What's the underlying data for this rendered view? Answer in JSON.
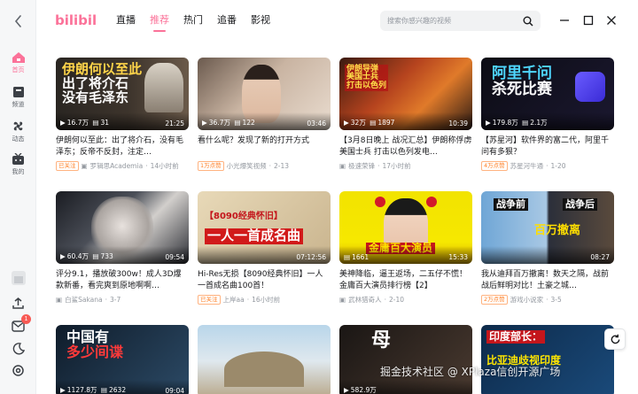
{
  "app": {
    "logo_text": "bilibili"
  },
  "header": {
    "tabs": [
      {
        "label": "直播",
        "active": false
      },
      {
        "label": "推荐",
        "active": true
      },
      {
        "label": "热门",
        "active": false
      },
      {
        "label": "追番",
        "active": false
      },
      {
        "label": "影视",
        "active": false
      }
    ],
    "search": {
      "placeholder": "搜索你感兴趣的视频"
    }
  },
  "sidebar": {
    "items": [
      {
        "label": "首页",
        "icon": "home-icon",
        "active": true
      },
      {
        "label": "频道",
        "icon": "channel-icon",
        "active": false
      },
      {
        "label": "动态",
        "icon": "dynamic-icon",
        "active": false
      },
      {
        "label": "我的",
        "icon": "my-icon",
        "active": false
      }
    ],
    "notification_count": "1"
  },
  "colors": {
    "accent": "#fb7299",
    "tag": "#ff7f24"
  },
  "videos": [
    {
      "thumb_text": "伊朗何以至此\n出了将介石\n没有毛泽东",
      "views": "16.7万",
      "comments": "31",
      "duration": "21:25",
      "title": "伊朗何以至此：出了将介石，没有毛泽东；反帝不反封，注定…",
      "tag": "已关注",
      "author": "罗辑思Academia",
      "time": "14小时前"
    },
    {
      "thumb_text": "",
      "views": "36.7万",
      "comments": "122",
      "duration": "03:46",
      "title": "看什么呢？发现了新的打开方式",
      "tag": "1万点赞",
      "author": "小光爆笑视频",
      "time": "2-13"
    },
    {
      "thumb_text": "伊朗导弹\n美国士兵\n打击以色列",
      "views": "32万",
      "comments": "1897",
      "duration": "10:39",
      "title": "【3月8日晚上 战况汇总】伊朗称俘虏美国士兵 打击以色列发电…",
      "tag": "",
      "author": "极速荣锋",
      "time": "17小时前"
    },
    {
      "thumb_text": "阿里千问\n杀死比赛",
      "views": "179.8万",
      "comments": "2.1万",
      "duration": "",
      "title": "【苏星河】软件界的富二代，阿里千问有多狠？",
      "tag": "4万点赞",
      "author": "苏星河牛通",
      "time": "1-20"
    },
    {
      "thumb_text": "",
      "views": "60.4万",
      "comments": "733",
      "duration": "09:54",
      "title": "评分9.1，播放破300w！成人3D爆款新番，看完爽到原地啊啊…",
      "tag": "",
      "author": "白鲨Sakana",
      "time": "3-7"
    },
    {
      "thumb_text": "【8090经典怀旧】\n一人一首成名曲",
      "views": "",
      "comments": "",
      "duration": "07:12:56",
      "title": "Hi-Res无损【8090经典怀旧】一人一首成名曲100首！",
      "tag": "已关注",
      "author": "上岸aa",
      "time": "16小时前"
    },
    {
      "thumb_text": "金庸百大演员",
      "views": "",
      "comments": "1661",
      "duration": "15:33",
      "title": "美神降临，逼王返场，二五仔不慌！金庸百大演员排行榜【2】",
      "tag": "",
      "author": "武林猎奇人",
      "time": "2-10"
    },
    {
      "thumb_text": "战争前  战争后\n百万撤离",
      "views": "",
      "comments": "",
      "duration": "08:27",
      "title": "我从迪拜百万撤离！数天之隔，战前战后鲜明对比！土豪之城…",
      "tag": "2万点赞",
      "author": "游戏小说家",
      "time": "3-5"
    },
    {
      "thumb_text": "中国有\n多少间谍",
      "views": "1127.8万",
      "comments": "2632",
      "duration": "09:04",
      "title": "",
      "tag": "",
      "author": "",
      "time": ""
    },
    {
      "thumb_text": "",
      "views": "",
      "comments": "",
      "duration": "",
      "title": "",
      "tag": "",
      "author": "",
      "time": ""
    },
    {
      "thumb_text": "",
      "views": "582.9万",
      "comments": "",
      "duration": "",
      "title": "",
      "tag": "",
      "author": "",
      "time": ""
    },
    {
      "thumb_text": "印度部长：\n比亚迪歧视印度",
      "views": "",
      "comments": "",
      "duration": "",
      "title": "",
      "tag": "",
      "author": "",
      "time": ""
    }
  ],
  "watermark": "掘金技术社区 @ XPlaza信创开源广场"
}
